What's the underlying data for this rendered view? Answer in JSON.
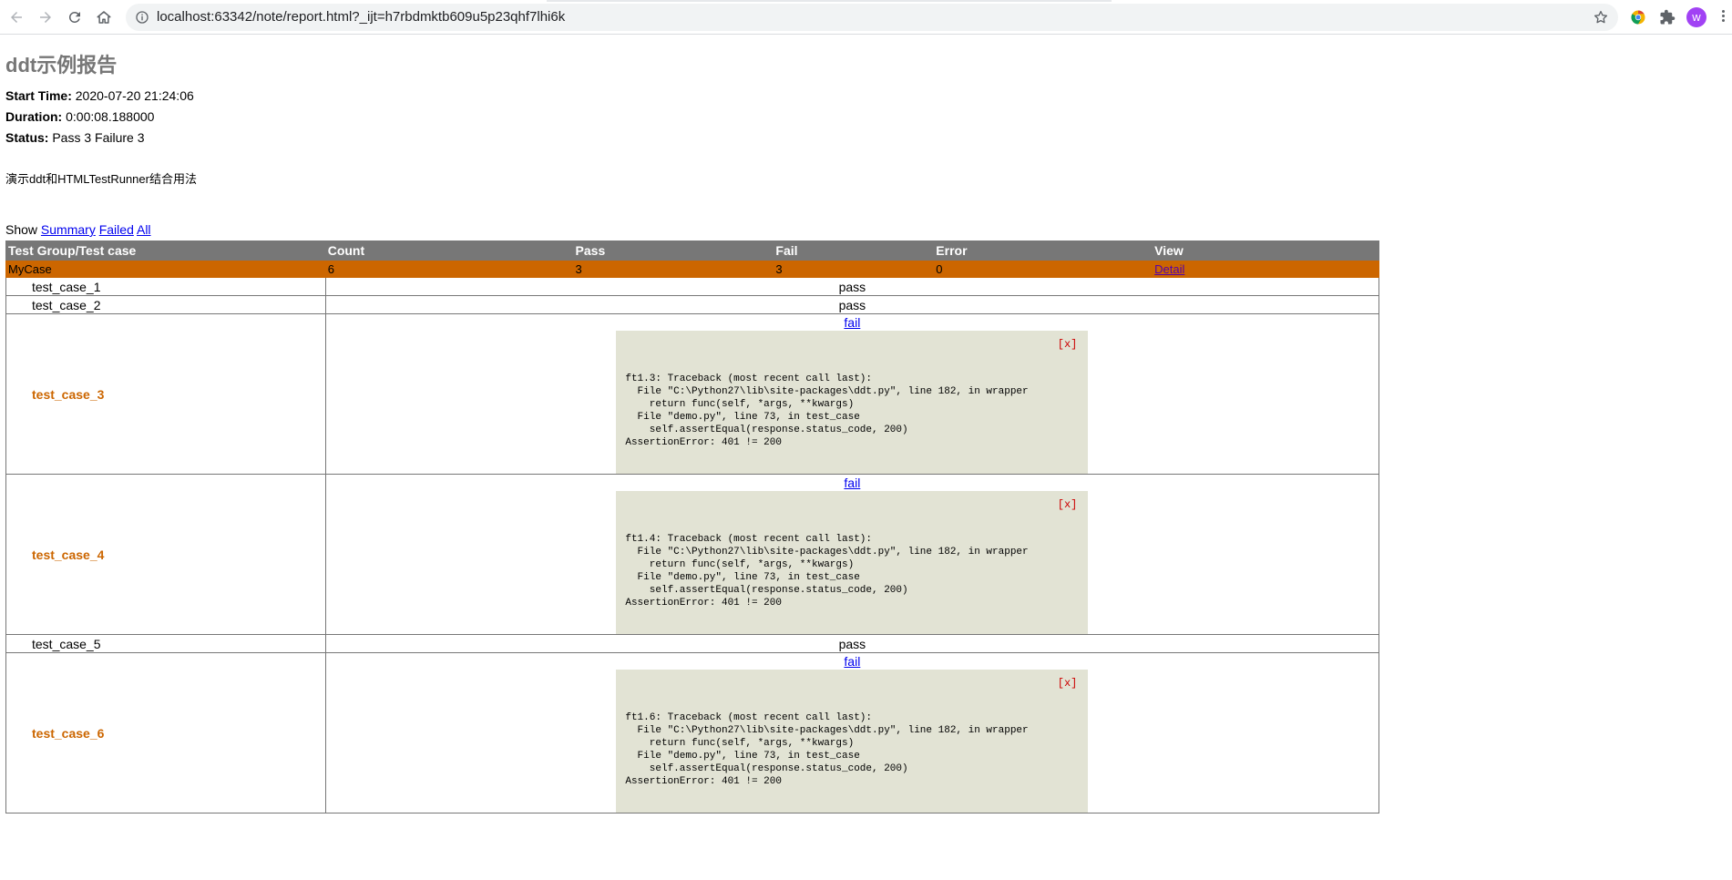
{
  "browser": {
    "url": "localhost:63342/note/report.html?_ijt=h7rbdmktb609u5p23qhf7lhi6k",
    "avatar_letter": "w"
  },
  "report": {
    "title": "ddt示例报告",
    "start_time_label": "Start Time:",
    "start_time": "2020-07-20 21:24:06",
    "duration_label": "Duration:",
    "duration": "0:00:08.188000",
    "status_label": "Status:",
    "status": "Pass 3 Failure 3",
    "description": "演示ddt和HTMLTestRunner结合用法",
    "show_label": "Show",
    "show_links": [
      "Summary",
      "Failed",
      "All"
    ]
  },
  "table": {
    "headers": [
      "Test Group/Test case",
      "Count",
      "Pass",
      "Fail",
      "Error",
      "View"
    ],
    "class_row": {
      "name": "MyCase",
      "count": "6",
      "pass": "3",
      "fail": "3",
      "error": "0",
      "view": "Detail"
    },
    "cases": [
      {
        "name": "test_case_1",
        "status": "pass"
      },
      {
        "name": "test_case_2",
        "status": "pass"
      },
      {
        "name": "test_case_3",
        "status": "fail",
        "close": "[x]",
        "traceback": "ft1.3: Traceback (most recent call last):\n  File \"C:\\Python27\\lib\\site-packages\\ddt.py\", line 182, in wrapper\n    return func(self, *args, **kwargs)\n  File \"demo.py\", line 73, in test_case\n    self.assertEqual(response.status_code, 200)\nAssertionError: 401 != 200"
      },
      {
        "name": "test_case_4",
        "status": "fail",
        "close": "[x]",
        "traceback": "ft1.4: Traceback (most recent call last):\n  File \"C:\\Python27\\lib\\site-packages\\ddt.py\", line 182, in wrapper\n    return func(self, *args, **kwargs)\n  File \"demo.py\", line 73, in test_case\n    self.assertEqual(response.status_code, 200)\nAssertionError: 401 != 200"
      },
      {
        "name": "test_case_5",
        "status": "pass"
      },
      {
        "name": "test_case_6",
        "status": "fail",
        "close": "[x]",
        "traceback": "ft1.6: Traceback (most recent call last):\n  File \"C:\\Python27\\lib\\site-packages\\ddt.py\", line 182, in wrapper\n    return func(self, *args, **kwargs)\n  File \"demo.py\", line 73, in test_case\n    self.assertEqual(response.status_code, 200)\nAssertionError: 401 != 200"
      }
    ]
  }
}
